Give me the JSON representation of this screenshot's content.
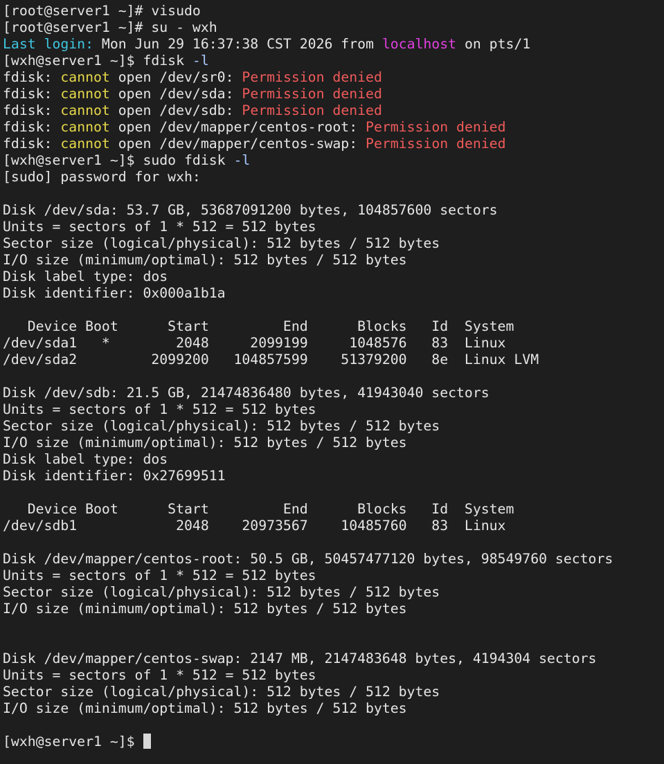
{
  "theme": {
    "background": "#1e1e1e",
    "foreground": "#e6e6e6",
    "cyan": "#3fc6e0",
    "magenta": "#e040e0",
    "yellow": "#e6d84a",
    "red": "#f05a5a"
  },
  "lines": [
    [
      {
        "t": "[root@server1 ~]# visudo"
      }
    ],
    [
      {
        "t": "[root@server1 ~]# su - wxh"
      }
    ],
    [
      {
        "t": "Last login:",
        "c": "cyan"
      },
      {
        "t": " Mon Jun 29 16:37:38 CST 2026 from "
      },
      {
        "t": "localhost",
        "c": "magenta"
      },
      {
        "t": " on pts/1"
      }
    ],
    [
      {
        "t": "[wxh@server1 ~]$ fdisk "
      },
      {
        "t": "-l",
        "c": "flag"
      }
    ],
    [
      {
        "t": "fdisk: "
      },
      {
        "t": "cannot",
        "c": "yellow"
      },
      {
        "t": " open /dev/sr0: "
      },
      {
        "t": "Permission denied",
        "c": "red"
      }
    ],
    [
      {
        "t": "fdisk: "
      },
      {
        "t": "cannot",
        "c": "yellow"
      },
      {
        "t": " open /dev/sda: "
      },
      {
        "t": "Permission denied",
        "c": "red"
      }
    ],
    [
      {
        "t": "fdisk: "
      },
      {
        "t": "cannot",
        "c": "yellow"
      },
      {
        "t": " open /dev/sdb: "
      },
      {
        "t": "Permission denied",
        "c": "red"
      }
    ],
    [
      {
        "t": "fdisk: "
      },
      {
        "t": "cannot",
        "c": "yellow"
      },
      {
        "t": " open /dev/mapper/centos-root: "
      },
      {
        "t": "Permission denied",
        "c": "red"
      }
    ],
    [
      {
        "t": "fdisk: "
      },
      {
        "t": "cannot",
        "c": "yellow"
      },
      {
        "t": " open /dev/mapper/centos-swap: "
      },
      {
        "t": "Permission denied",
        "c": "red"
      }
    ],
    [
      {
        "t": "[wxh@server1 ~]$ sudo fdisk "
      },
      {
        "t": "-l",
        "c": "flag"
      }
    ],
    [
      {
        "t": "[sudo] password for wxh:"
      }
    ],
    [
      {
        "t": ""
      }
    ],
    [
      {
        "t": "Disk /dev/sda: 53.7 GB, 53687091200 bytes, 104857600 sectors"
      }
    ],
    [
      {
        "t": "Units = sectors of 1 * 512 = 512 bytes"
      }
    ],
    [
      {
        "t": "Sector size (logical/physical): 512 bytes / 512 bytes"
      }
    ],
    [
      {
        "t": "I/O size (minimum/optimal): 512 bytes / 512 bytes"
      }
    ],
    [
      {
        "t": "Disk label type: dos"
      }
    ],
    [
      {
        "t": "Disk identifier: 0x000a1b1a"
      }
    ],
    [
      {
        "t": ""
      }
    ],
    [
      {
        "t": "   Device Boot      Start         End      Blocks   Id  System"
      }
    ],
    [
      {
        "t": "/dev/sda1   *        2048     2099199     1048576   83  Linux"
      }
    ],
    [
      {
        "t": "/dev/sda2         2099200   104857599    51379200   8e  Linux LVM"
      }
    ],
    [
      {
        "t": ""
      }
    ],
    [
      {
        "t": "Disk /dev/sdb: 21.5 GB, 21474836480 bytes, 41943040 sectors"
      }
    ],
    [
      {
        "t": "Units = sectors of 1 * 512 = 512 bytes"
      }
    ],
    [
      {
        "t": "Sector size (logical/physical): 512 bytes / 512 bytes"
      }
    ],
    [
      {
        "t": "I/O size (minimum/optimal): 512 bytes / 512 bytes"
      }
    ],
    [
      {
        "t": "Disk label type: dos"
      }
    ],
    [
      {
        "t": "Disk identifier: 0x27699511"
      }
    ],
    [
      {
        "t": ""
      }
    ],
    [
      {
        "t": "   Device Boot      Start         End      Blocks   Id  System"
      }
    ],
    [
      {
        "t": "/dev/sdb1            2048    20973567    10485760   83  Linux"
      }
    ],
    [
      {
        "t": ""
      }
    ],
    [
      {
        "t": "Disk /dev/mapper/centos-root: 50.5 GB, 50457477120 bytes, 98549760 sectors"
      }
    ],
    [
      {
        "t": "Units = sectors of 1 * 512 = 512 bytes"
      }
    ],
    [
      {
        "t": "Sector size (logical/physical): 512 bytes / 512 bytes"
      }
    ],
    [
      {
        "t": "I/O size (minimum/optimal): 512 bytes / 512 bytes"
      }
    ],
    [
      {
        "t": ""
      }
    ],
    [
      {
        "t": ""
      }
    ],
    [
      {
        "t": "Disk /dev/mapper/centos-swap: 2147 MB, 2147483648 bytes, 4194304 sectors"
      }
    ],
    [
      {
        "t": "Units = sectors of 1 * 512 = 512 bytes"
      }
    ],
    [
      {
        "t": "Sector size (logical/physical): 512 bytes / 512 bytes"
      }
    ],
    [
      {
        "t": "I/O size (minimum/optimal): 512 bytes / 512 bytes"
      }
    ],
    [
      {
        "t": ""
      }
    ]
  ],
  "prompt": {
    "text": "[wxh@server1 ~]$"
  }
}
